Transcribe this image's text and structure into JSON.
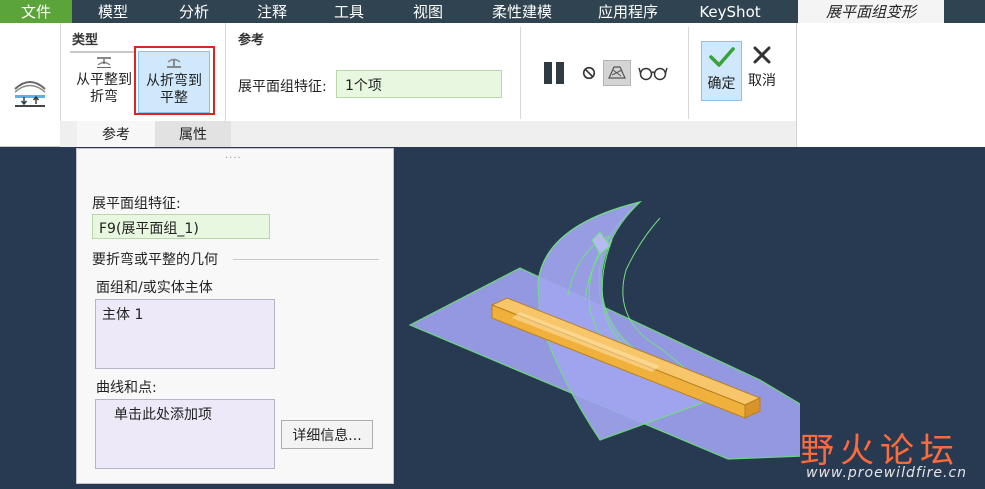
{
  "menubar": {
    "items": [
      "文件",
      "模型",
      "分析",
      "注释",
      "工具",
      "视图",
      "柔性建模",
      "应用程序",
      "KeyShot"
    ],
    "active": "展平面组变形"
  },
  "ribbon": {
    "type_group": {
      "title": "类型",
      "flat_to_bend": [
        "从平整到",
        "折弯"
      ],
      "bend_to_flat": [
        "从折弯到",
        "平整"
      ]
    },
    "reference_group": {
      "title": "参考",
      "label": "展平面组特征:",
      "value": "1个项"
    },
    "ok_label": "确定",
    "cancel_label": "取消",
    "tabs": [
      "参考",
      "属性"
    ]
  },
  "panel": {
    "grip": "....",
    "feature_label": "展平面组特征:",
    "feature_value": "F9(展平面组_1)",
    "geometry_title": "要折弯或平整的几何",
    "body_label": "面组和/或实体主体",
    "body_item": "主体 1",
    "curves_label": "曲线和点:",
    "curves_placeholder": "单击此处添加项",
    "detail_button": "详细信息..."
  },
  "watermark": {
    "title": "野火论坛",
    "url": "www.proewildfire.cn"
  },
  "colors": {
    "menubar_bg": "#2f4350",
    "file_tab": "#5aa43a",
    "viewport_bg": "#283a52",
    "input_green": "#e8f7df",
    "selected_blue": "#cfe8fb",
    "highlight_red": "#e02222",
    "model_sheet": "#9a9ee8",
    "model_edge": "#7cf08c",
    "model_bar": "#f0b03c"
  }
}
